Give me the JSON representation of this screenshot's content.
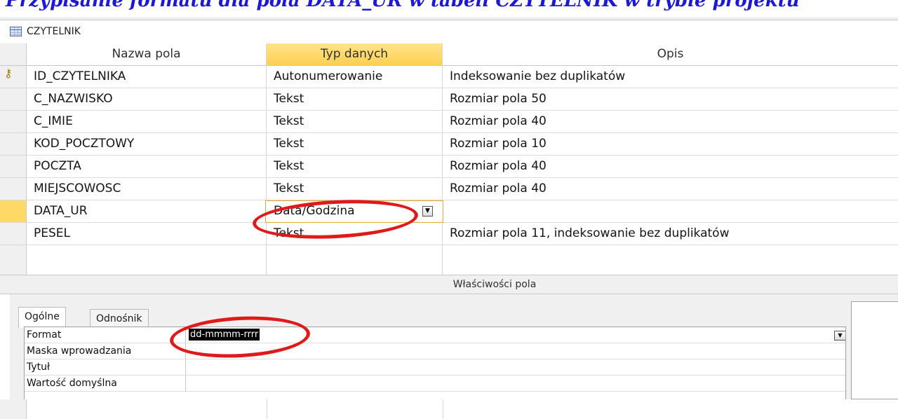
{
  "page_heading": "Przypisanie formatu dla pola DATA_UR w tabeli CZYTELNIK w trybie projektu",
  "table_tab": {
    "title": "CZYTELNIK",
    "icon": "table-icon"
  },
  "grid": {
    "headers": {
      "name": "Nazwa pola",
      "type": "Typ danych",
      "desc": "Opis"
    },
    "rows": [
      {
        "name": "ID_CZYTELNIKA",
        "type": "Autonumerowanie",
        "desc": "Indeksowanie bez duplikatów"
      },
      {
        "name": "C_NAZWISKO",
        "type": "Tekst",
        "desc": "Rozmiar pola 50"
      },
      {
        "name": "C_IMIE",
        "type": "Tekst",
        "desc": "Rozmiar pola 40"
      },
      {
        "name": "KOD_POCZTOWY",
        "type": "Tekst",
        "desc": "Rozmiar pola 10"
      },
      {
        "name": "POCZTA",
        "type": "Tekst",
        "desc": "Rozmiar pola 40"
      },
      {
        "name": "MIEJSCOWOSC",
        "type": "Tekst",
        "desc": "Rozmiar pola 40"
      },
      {
        "name": "DATA_UR",
        "type": "Data/Godzina",
        "desc": ""
      },
      {
        "name": "PESEL",
        "type": "Tekst",
        "desc": "Rozmiar pola 11, indeksowanie bez duplikatów"
      }
    ]
  },
  "properties": {
    "section_title": "Właściwości pola",
    "tabs": {
      "general": "Ogólne",
      "lookup": "Odnośnik"
    },
    "rows": [
      {
        "label": "Format",
        "value": "dd-mmmm-rrrr"
      },
      {
        "label": "Maska wprowadzania",
        "value": ""
      },
      {
        "label": "Tytuł",
        "value": ""
      },
      {
        "label": "Wartość domyślna",
        "value": ""
      }
    ]
  },
  "colors": {
    "heading": "#1d17d6",
    "highlight": "#ffd965",
    "annotation": "#e01a1a"
  }
}
